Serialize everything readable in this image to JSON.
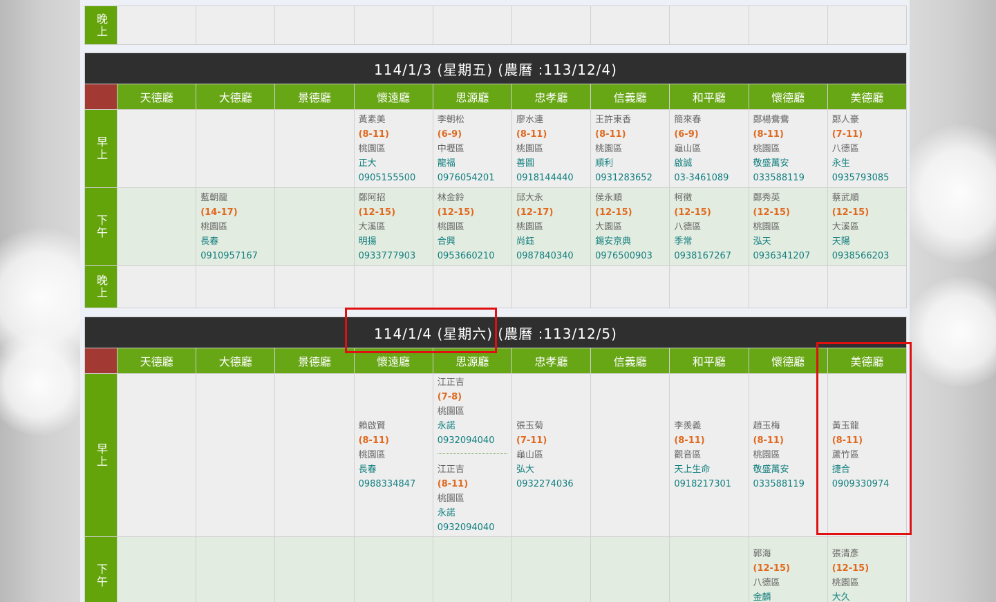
{
  "halls": [
    "天德廳",
    "大德廳",
    "景德廳",
    "懷遠廳",
    "思源廳",
    "忠孝廳",
    "信義廳",
    "和平廳",
    "懷德廳",
    "美德廳"
  ],
  "slots": {
    "am": "早上",
    "pm": "下午",
    "ev": "晚上"
  },
  "days": [
    {
      "title": "114/1/3 (星期五) (農曆 :113/12/4)",
      "am": [
        [],
        [],
        [],
        [
          {
            "name": "黃素美",
            "time": "(8-11)",
            "area": "桃園區",
            "temple": "正大",
            "phone": "0905155500"
          }
        ],
        [
          {
            "name": "李朝松",
            "time": "(6-9)",
            "area": "中壢區",
            "temple": "龍福",
            "phone": "0976054201"
          }
        ],
        [
          {
            "name": "廖水連",
            "time": "(8-11)",
            "area": "桃園區",
            "temple": "善圓",
            "phone": "0918144440"
          }
        ],
        [
          {
            "name": "王許東香",
            "time": "(8-11)",
            "area": "桃園區",
            "temple": "順利",
            "phone": "0931283652"
          }
        ],
        [
          {
            "name": "簡來春",
            "time": "(6-9)",
            "area": "龜山區",
            "temple": "啟誠",
            "phone": "03-3461089"
          }
        ],
        [
          {
            "name": "鄭楊鴦鴦",
            "time": "(8-11)",
            "area": "桃園區",
            "temple": "敬盛萬安",
            "phone": "033588119"
          }
        ],
        [
          {
            "name": "鄭人豪",
            "time": "(7-11)",
            "area": "八德區",
            "temple": "永生",
            "phone": "0935793085"
          }
        ]
      ],
      "pm": [
        [],
        [
          {
            "name": "藍朝龍",
            "time": "(14-17)",
            "area": "桃園區",
            "temple": "長春",
            "phone": "0910957167"
          }
        ],
        [],
        [
          {
            "name": "鄭阿招",
            "time": "(12-15)",
            "area": "大溪區",
            "temple": "明揚",
            "phone": "0933777903"
          }
        ],
        [
          {
            "name": "林金鈴",
            "time": "(12-15)",
            "area": "桃園區",
            "temple": "合興",
            "phone": "0953660210"
          }
        ],
        [
          {
            "name": "邱大永",
            "time": "(12-17)",
            "area": "桃園區",
            "temple": "尚鈺",
            "phone": "0987840340"
          }
        ],
        [
          {
            "name": "侯永順",
            "time": "(12-15)",
            "area": "大園區",
            "temple": "錫安京典",
            "phone": "0976500903"
          }
        ],
        [
          {
            "name": "柯徵",
            "time": "(12-15)",
            "area": "八德區",
            "temple": "季常",
            "phone": "0938167267"
          }
        ],
        [
          {
            "name": "鄭秀英",
            "time": "(12-15)",
            "area": "桃園區",
            "temple": "泓天",
            "phone": "0936341207"
          }
        ],
        [
          {
            "name": "蔡武順",
            "time": "(12-15)",
            "area": "大溪區",
            "temple": "天陽",
            "phone": "0938566203"
          }
        ]
      ]
    },
    {
      "title": "114/1/4 (星期六) (農曆 :113/12/5)",
      "am": [
        [],
        [],
        [],
        [
          {
            "name": "賴啟賢",
            "time": "(8-11)",
            "area": "桃園區",
            "temple": "長春",
            "phone": "0988334847"
          }
        ],
        [
          {
            "name": "江正吉",
            "time": "(7-8)",
            "area": "桃園區",
            "temple": "永諾",
            "phone": "0932094040"
          },
          {
            "name": "江正吉",
            "time": "(8-11)",
            "area": "桃園區",
            "temple": "永諾",
            "phone": "0932094040"
          }
        ],
        [
          {
            "name": "張玉菊",
            "time": "(7-11)",
            "area": "龜山區",
            "temple": "弘大",
            "phone": "0932274036"
          }
        ],
        [],
        [
          {
            "name": "李羨義",
            "time": "(8-11)",
            "area": "觀音區",
            "temple": "天上生命",
            "phone": "0918217301"
          }
        ],
        [
          {
            "name": "趙玉梅",
            "time": "(8-11)",
            "area": "桃園區",
            "temple": "敬盛萬安",
            "phone": "033588119"
          }
        ],
        [
          {
            "name": "黃玉龍",
            "time": "(8-11)",
            "area": "蘆竹區",
            "temple": "捷合",
            "phone": "0909330974"
          }
        ]
      ],
      "pm": [
        [],
        [],
        [],
        [],
        [],
        [],
        [],
        [],
        [
          {
            "name": "郭海",
            "time": "(12-15)",
            "area": "八德區",
            "temple": "金麟"
          }
        ],
        [
          {
            "name": "張清彥",
            "time": "(12-15)",
            "area": "桃園區",
            "temple": "大久"
          }
        ]
      ]
    }
  ]
}
